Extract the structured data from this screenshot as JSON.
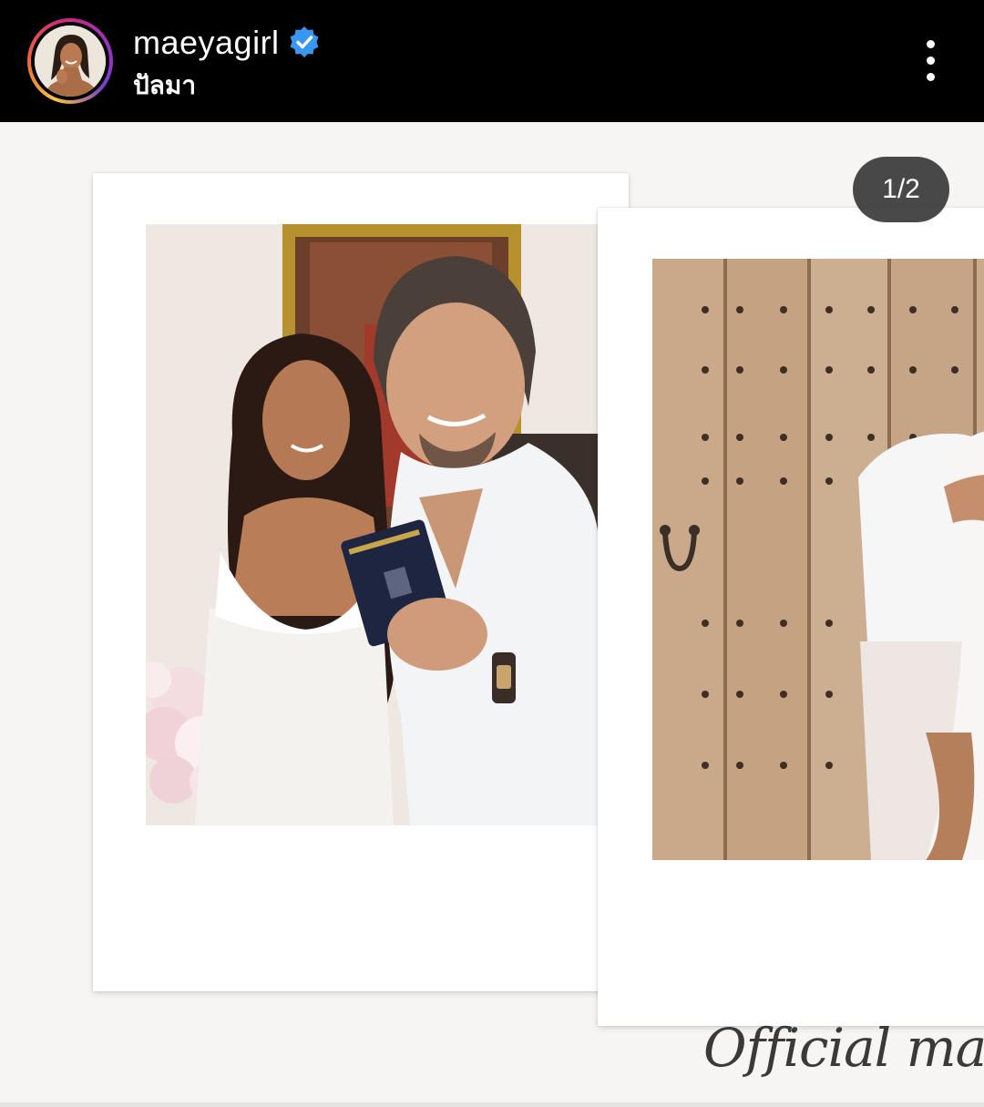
{
  "header": {
    "username": "maeyagirl",
    "subtitle": "ปัลมา",
    "verified": true,
    "avatar_icon": "profile-avatar",
    "more_icon": "more-vertical-icon"
  },
  "post": {
    "page_counter": "1/2",
    "caption": "Official marri",
    "photos": [
      {
        "icon": "wedding-couple-photo"
      },
      {
        "icon": "wooden-door-couple-photo"
      }
    ]
  },
  "colors": {
    "header_bg": "#000000",
    "verified_blue": "#3897f0",
    "counter_bg": "#303030"
  }
}
